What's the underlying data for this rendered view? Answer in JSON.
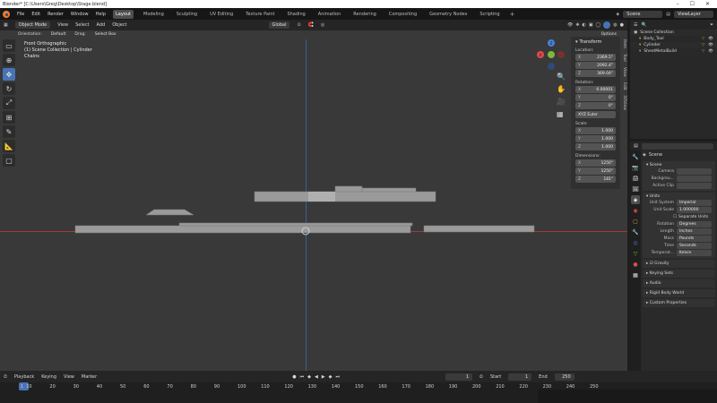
{
  "title_bar": {
    "text": "Blender* [C:\\Users\\Greg\\Desktop\\Stage.blend]"
  },
  "menu": [
    "File",
    "Edit",
    "Render",
    "Window",
    "Help"
  ],
  "workspaces": [
    "Layout",
    "Modeling",
    "Sculpting",
    "UV Editing",
    "Texture Paint",
    "Shading",
    "Animation",
    "Rendering",
    "Compositing",
    "Geometry Nodes",
    "Scripting"
  ],
  "active_workspace": "Layout",
  "scene_field": "Scene",
  "viewlayer_field": "ViewLayer",
  "viewport_header": {
    "mode": "Object Mode",
    "menus": [
      "View",
      "Select",
      "Add",
      "Object"
    ],
    "transform_orientation": "Global"
  },
  "tool_settings": {
    "orientation_label": "Orientation:",
    "orientation_value": "Default",
    "drag_label": "Drag:",
    "drag_value": "Select Box",
    "options": "Options"
  },
  "viewport_info": {
    "view": "Front Orthographic",
    "collection": "(1) Scene Collection | Cylinder",
    "units": "Chains"
  },
  "n_panel": {
    "header": "Transform",
    "location_label": "Location:",
    "location": [
      {
        "axis": "X",
        "value": "2369.5\""
      },
      {
        "axis": "Y",
        "value": "2092.4\""
      },
      {
        "axis": "Z",
        "value": "369.04\""
      }
    ],
    "rotation_label": "Rotation:",
    "rotation": [
      {
        "axis": "X",
        "value": "0.00001"
      },
      {
        "axis": "Y",
        "value": "0°"
      },
      {
        "axis": "Z",
        "value": "0°"
      }
    ],
    "rotation_mode": "XYZ Euler",
    "scale_label": "Scale:",
    "scale": [
      {
        "axis": "X",
        "value": "1.000"
      },
      {
        "axis": "Y",
        "value": "1.000"
      },
      {
        "axis": "Z",
        "value": "1.000"
      }
    ],
    "dimensions_label": "Dimensions:",
    "dimensions": [
      {
        "axis": "X",
        "value": "1250\""
      },
      {
        "axis": "Y",
        "value": "1250\""
      },
      {
        "axis": "Z",
        "value": "181\""
      }
    ],
    "tabs": [
      "Item",
      "Tool",
      "View",
      "Edit",
      "3DView"
    ]
  },
  "outliner": {
    "root": "Scene Collection",
    "items": [
      "Body_Tool",
      "Cylinder",
      "SheetMetalBuild"
    ]
  },
  "properties": {
    "search_placeholder": "",
    "context": "Scene",
    "scene_section": "Scene",
    "camera_label": "Camera",
    "background_label": "Backgrou...",
    "active_clip_label": "Active Clip",
    "units_section": "Units",
    "unit_system_label": "Unit System",
    "unit_system": "Imperial",
    "unit_scale_label": "Unit Scale",
    "unit_scale": "1.000000",
    "separate_units": "Separate Units",
    "rotation_label": "Rotation",
    "rotation": "Degrees",
    "length_label": "Length",
    "length": "Inches",
    "mass_label": "Mass",
    "mass": "Pounds",
    "time_label": "Time",
    "time": "Seconds",
    "temperature_label": "Temperat...",
    "temperature": "Kelvin",
    "collapsed": [
      "Gravity",
      "Keying Sets",
      "Audio",
      "Rigid Body World",
      "Custom Properties"
    ]
  },
  "timeline": {
    "menus": [
      "Playback",
      "Keying",
      "View",
      "Marker"
    ],
    "current_frame": "1",
    "start_label": "Start",
    "start": "1",
    "end_label": "End",
    "end": "250",
    "ticks": [
      "1",
      "10",
      "20",
      "30",
      "40",
      "50",
      "60",
      "70",
      "80",
      "90",
      "100",
      "110",
      "120",
      "130",
      "140",
      "150",
      "160",
      "170",
      "180",
      "190",
      "200",
      "210",
      "220",
      "230",
      "240",
      "250"
    ]
  },
  "colors": {
    "accent_blue": "#4873b6",
    "x_axis_red": "#e04a4a",
    "y_axis_green": "#7db83a",
    "z_axis_blue": "#4a7fd8",
    "logo_orange": "#f5792a"
  }
}
